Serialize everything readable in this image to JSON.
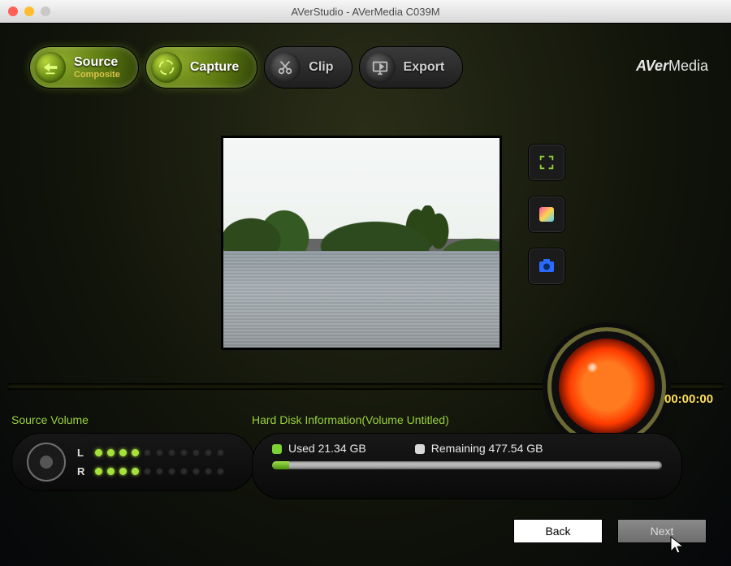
{
  "window": {
    "title": "AVerStudio - AVerMedia C039M"
  },
  "brand": {
    "prefix": "AVer",
    "suffix": "Media"
  },
  "steps": {
    "source": {
      "label": "Source",
      "sub": "Composite",
      "active": true,
      "icon": "source-icon"
    },
    "capture": {
      "label": "Capture",
      "active": true,
      "icon": "capture-icon"
    },
    "clip": {
      "label": "Clip",
      "active": false,
      "icon": "clip-icon"
    },
    "export": {
      "label": "Export",
      "active": false,
      "icon": "export-icon"
    }
  },
  "sideTools": {
    "fullscreen": "fullscreen-icon",
    "color": "color-icon",
    "snapshot": "snapshot-icon"
  },
  "timer": "00:00:00",
  "sourceVolume": {
    "label": "Source Volume",
    "L": {
      "label": "L",
      "lit": 4,
      "total": 11
    },
    "R": {
      "label": "R",
      "lit": 4,
      "total": 11
    }
  },
  "disk": {
    "label": "Hard Disk Information(Volume Untitled)",
    "usedLabel": "Used 21.34 GB",
    "remainingLabel": "Remaining 477.54 GB",
    "usedGB": 21.34,
    "totalGB": 498.88
  },
  "footer": {
    "back": "Back",
    "next": "Next"
  }
}
